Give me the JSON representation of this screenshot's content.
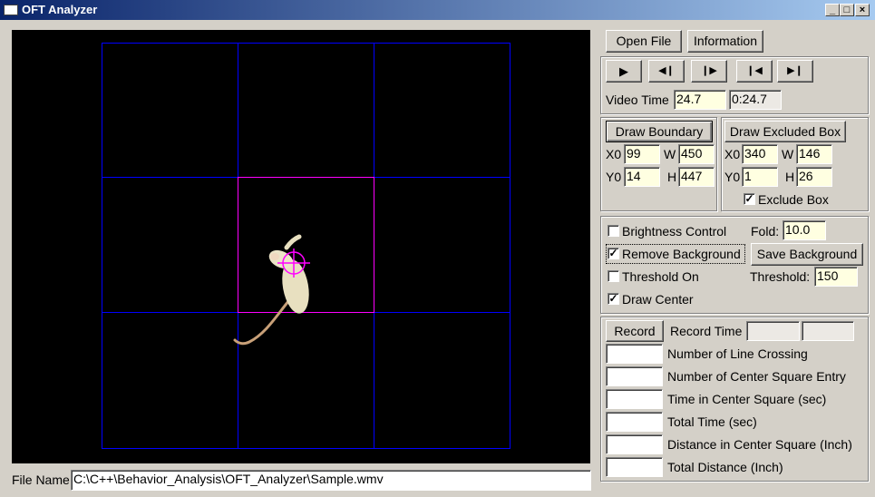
{
  "window": {
    "title": "OFT Analyzer",
    "minimize": "_",
    "maximize": "□",
    "close": "×"
  },
  "file_controls": {
    "open_file": "Open File",
    "information": "Information"
  },
  "playback": {
    "play": "▶",
    "step_back": "◀❙",
    "step_forward": "❙▶",
    "go_start": "❙◀",
    "go_end": "▶❙",
    "video_time_label": "Video Time",
    "video_time_value": "24.7",
    "video_time_display": "0:24.7"
  },
  "boundary": {
    "draw_button": "Draw Boundary",
    "x0_label": "X0",
    "x0": "99",
    "w_label": "W",
    "w": "450",
    "y0_label": "Y0",
    "y0": "14",
    "h_label": "H",
    "h": "447"
  },
  "excluded_box": {
    "draw_button": "Draw Excluded Box",
    "x0_label": "X0",
    "x0": "340",
    "w_label": "W",
    "w": "146",
    "y0_label": "Y0",
    "y0": "1",
    "h_label": "H",
    "h": "26",
    "exclude_label": "Exclude Box",
    "exclude_checked": true
  },
  "processing": {
    "brightness_label": "Brightness Control",
    "brightness_checked": false,
    "fold_label": "Fold:",
    "fold_value": "10.0",
    "remove_bg_label": "Remove Background",
    "remove_bg_checked": true,
    "save_bg_button": "Save Background",
    "threshold_on_label": "Threshold On",
    "threshold_on_checked": false,
    "threshold_label": "Threshold:",
    "threshold_value": "150",
    "draw_center_label": "Draw Center",
    "draw_center_checked": true
  },
  "recording": {
    "record_button": "Record",
    "record_time_label": "Record Time",
    "record_time_value1": "",
    "record_time_value2": "",
    "metrics": [
      {
        "label": "Number of Line Crossing",
        "value": ""
      },
      {
        "label": "Number of Center Square Entry",
        "value": ""
      },
      {
        "label": "Time in Center Square (sec)",
        "value": ""
      },
      {
        "label": "Total Time (sec)",
        "value": ""
      },
      {
        "label": "Distance in Center Square (Inch)",
        "value": ""
      },
      {
        "label": "Total Distance (Inch)",
        "value": ""
      }
    ]
  },
  "file_name": {
    "label": "File Name",
    "path": "C:\\C++\\Behavior_Analysis\\OFT_Analyzer\\Sample.wmv"
  },
  "colors": {
    "grid": "#0000ff",
    "center_square": "#ff00ff",
    "crosshair": "#ff00ff",
    "background": "#000000"
  }
}
